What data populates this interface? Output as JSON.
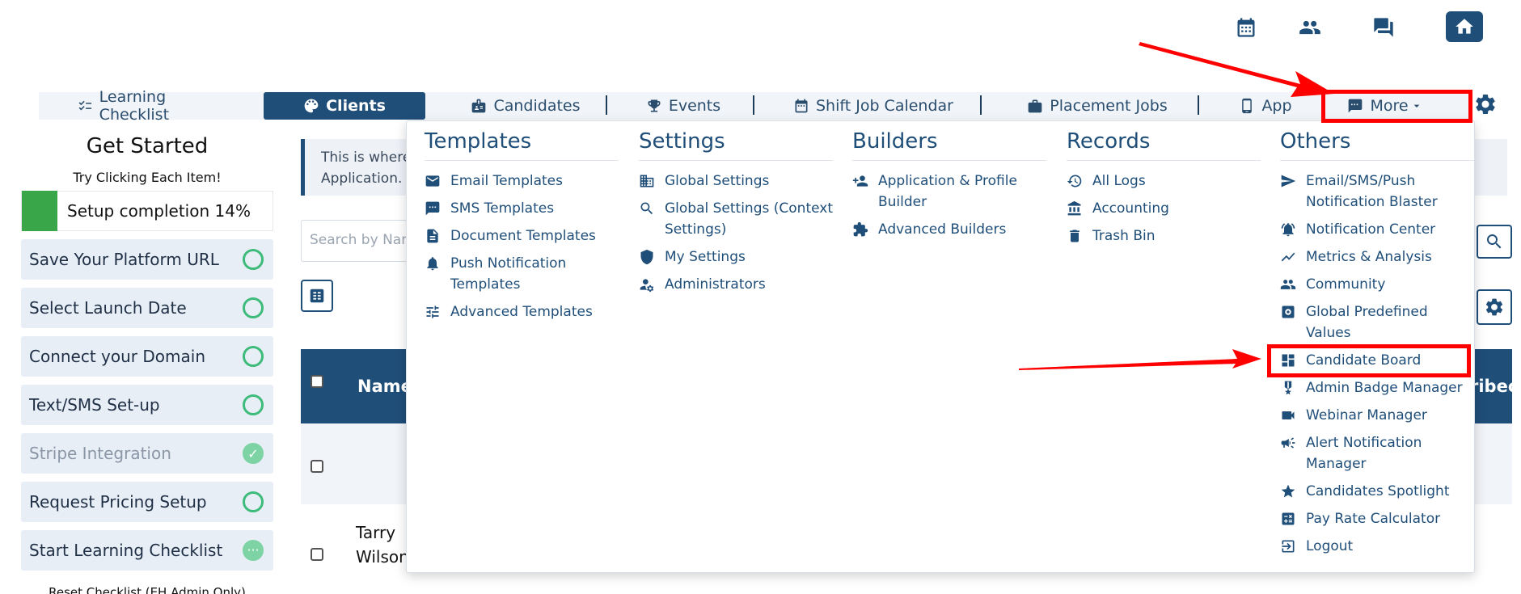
{
  "top_icons": [
    "calendar-icon",
    "people-icon",
    "chat-icon",
    "home-icon"
  ],
  "nav": {
    "tabs": [
      {
        "label": "Learning Checklist",
        "icon": "checklist-icon"
      },
      {
        "label": "Clients",
        "icon": "palette-icon",
        "active": true
      },
      {
        "label": "Candidates",
        "icon": "id-badge-icon"
      },
      {
        "label": "Events",
        "icon": "trophy-icon"
      },
      {
        "label": "Shift Job Calendar",
        "icon": "calendar-icon"
      },
      {
        "label": "Placement Jobs",
        "icon": "briefcase-icon"
      },
      {
        "label": "App",
        "icon": "phone-icon"
      },
      {
        "label": "More",
        "icon": "chat-bubble-icon"
      }
    ]
  },
  "left_panel": {
    "title": "Get Started",
    "subtitle": "Try Clicking Each Item!",
    "progress_label": "Setup completion 14%",
    "progress_fraction": 0.14,
    "items": [
      {
        "label": "Save Your Platform URL",
        "status": "pending"
      },
      {
        "label": "Select Launch Date",
        "status": "pending"
      },
      {
        "label": "Connect your Domain",
        "status": "pending"
      },
      {
        "label": "Text/SMS Set-up",
        "status": "pending"
      },
      {
        "label": "Stripe Integration",
        "status": "done"
      },
      {
        "label": "Request Pricing Setup",
        "status": "pending"
      },
      {
        "label": "Start Learning Checklist",
        "status": "in-progress"
      }
    ],
    "reset_label": "Reset Checklist (EH Admin Only)"
  },
  "main": {
    "info_line1": "This is where",
    "info_line2": "Application.",
    "search_placeholder": "Search by Nam",
    "table_header_name": "Name",
    "table_header_right": "ribec",
    "row_name_line1": "Tarry",
    "row_name_line2": "Wilson"
  },
  "dropdown": {
    "templates": {
      "title": "Templates",
      "items": [
        {
          "label": "Email Templates"
        },
        {
          "label": "SMS Templates"
        },
        {
          "label": "Document Templates"
        },
        {
          "label": "Push Notification Templates"
        },
        {
          "label": "Advanced Templates"
        }
      ]
    },
    "settings": {
      "title": "Settings",
      "items": [
        {
          "label": "Global Settings"
        },
        {
          "label": "Global Settings (Context Settings)"
        },
        {
          "label": "My Settings"
        },
        {
          "label": "Administrators"
        }
      ]
    },
    "builders": {
      "title": "Builders",
      "items": [
        {
          "label": "Application & Profile Builder"
        },
        {
          "label": "Advanced Builders"
        }
      ]
    },
    "records": {
      "title": "Records",
      "items": [
        {
          "label": "All Logs"
        },
        {
          "label": "Accounting"
        },
        {
          "label": "Trash Bin"
        }
      ]
    },
    "others": {
      "title": "Others",
      "items": [
        {
          "label": "Email/SMS/Push Notification Blaster"
        },
        {
          "label": "Notification Center"
        },
        {
          "label": "Metrics & Analysis"
        },
        {
          "label": "Community"
        },
        {
          "label": "Global Predefined Values"
        },
        {
          "label": "Candidate Board"
        },
        {
          "label": "Admin Badge Manager"
        },
        {
          "label": "Webinar Manager"
        },
        {
          "label": "Alert Notification Manager"
        },
        {
          "label": "Candidates Spotlight"
        },
        {
          "label": "Pay Rate Calculator"
        },
        {
          "label": "Logout"
        }
      ]
    }
  },
  "colors": {
    "primary": "#1f4e79",
    "highlight": "#ff0000",
    "progress": "#3aa64a",
    "check_ring": "#3dbb7a"
  }
}
